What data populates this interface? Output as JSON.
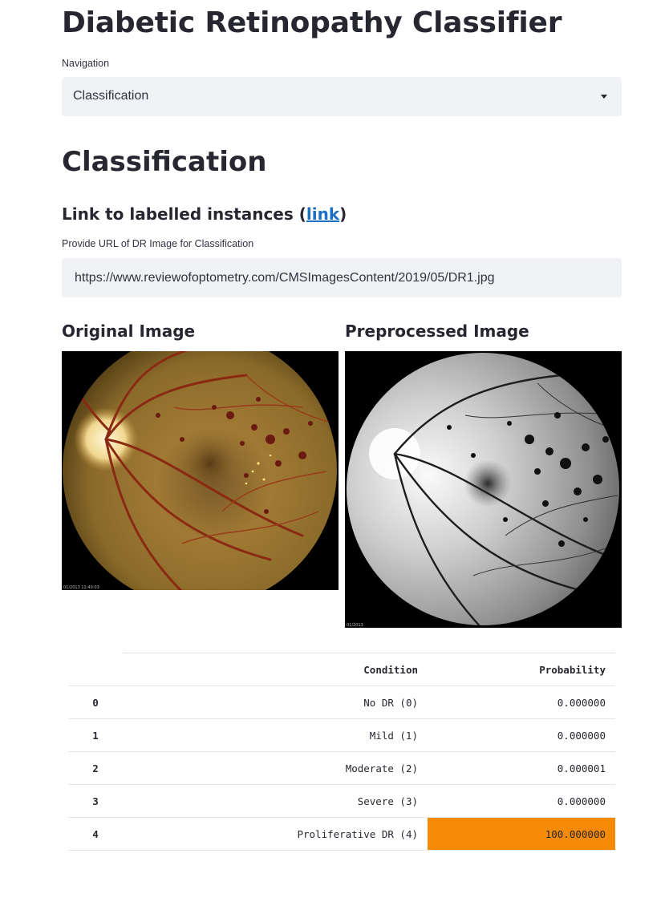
{
  "app": {
    "title": "Diabetic Retinopathy Classifier"
  },
  "navigation": {
    "label": "Navigation",
    "selected": "Classification",
    "caret_icon": "caret-down-icon"
  },
  "section": {
    "title": "Classification",
    "subheading_text": "Link to labelled instances (",
    "subheading_link": "link",
    "subheading_close": ")"
  },
  "url_field": {
    "label": "Provide URL of DR Image for Classification",
    "value": "https://www.reviewofoptometry.com/CMSImagesContent/2019/05/DR1.jpg"
  },
  "images": {
    "original_caption": "Original Image",
    "preprocessed_caption": "Preprocessed Image"
  },
  "results_table": {
    "headers": [
      "",
      "Condition",
      "Probability"
    ],
    "rows": [
      {
        "index": "0",
        "condition": "No DR (0)",
        "probability": "0.000000"
      },
      {
        "index": "1",
        "condition": "Mild (1)",
        "probability": "0.000000"
      },
      {
        "index": "2",
        "condition": "Moderate (2)",
        "probability": "0.000001"
      },
      {
        "index": "3",
        "condition": "Severe (3)",
        "probability": "0.000000"
      },
      {
        "index": "4",
        "condition": "Proliferative DR (4)",
        "probability": "100.000000"
      }
    ],
    "highlight_color": "#f58a07",
    "highlight_row": 4
  },
  "colors": {
    "input_background": "#f0f2f6",
    "link": "#1c6fc7",
    "text": "#262730"
  }
}
